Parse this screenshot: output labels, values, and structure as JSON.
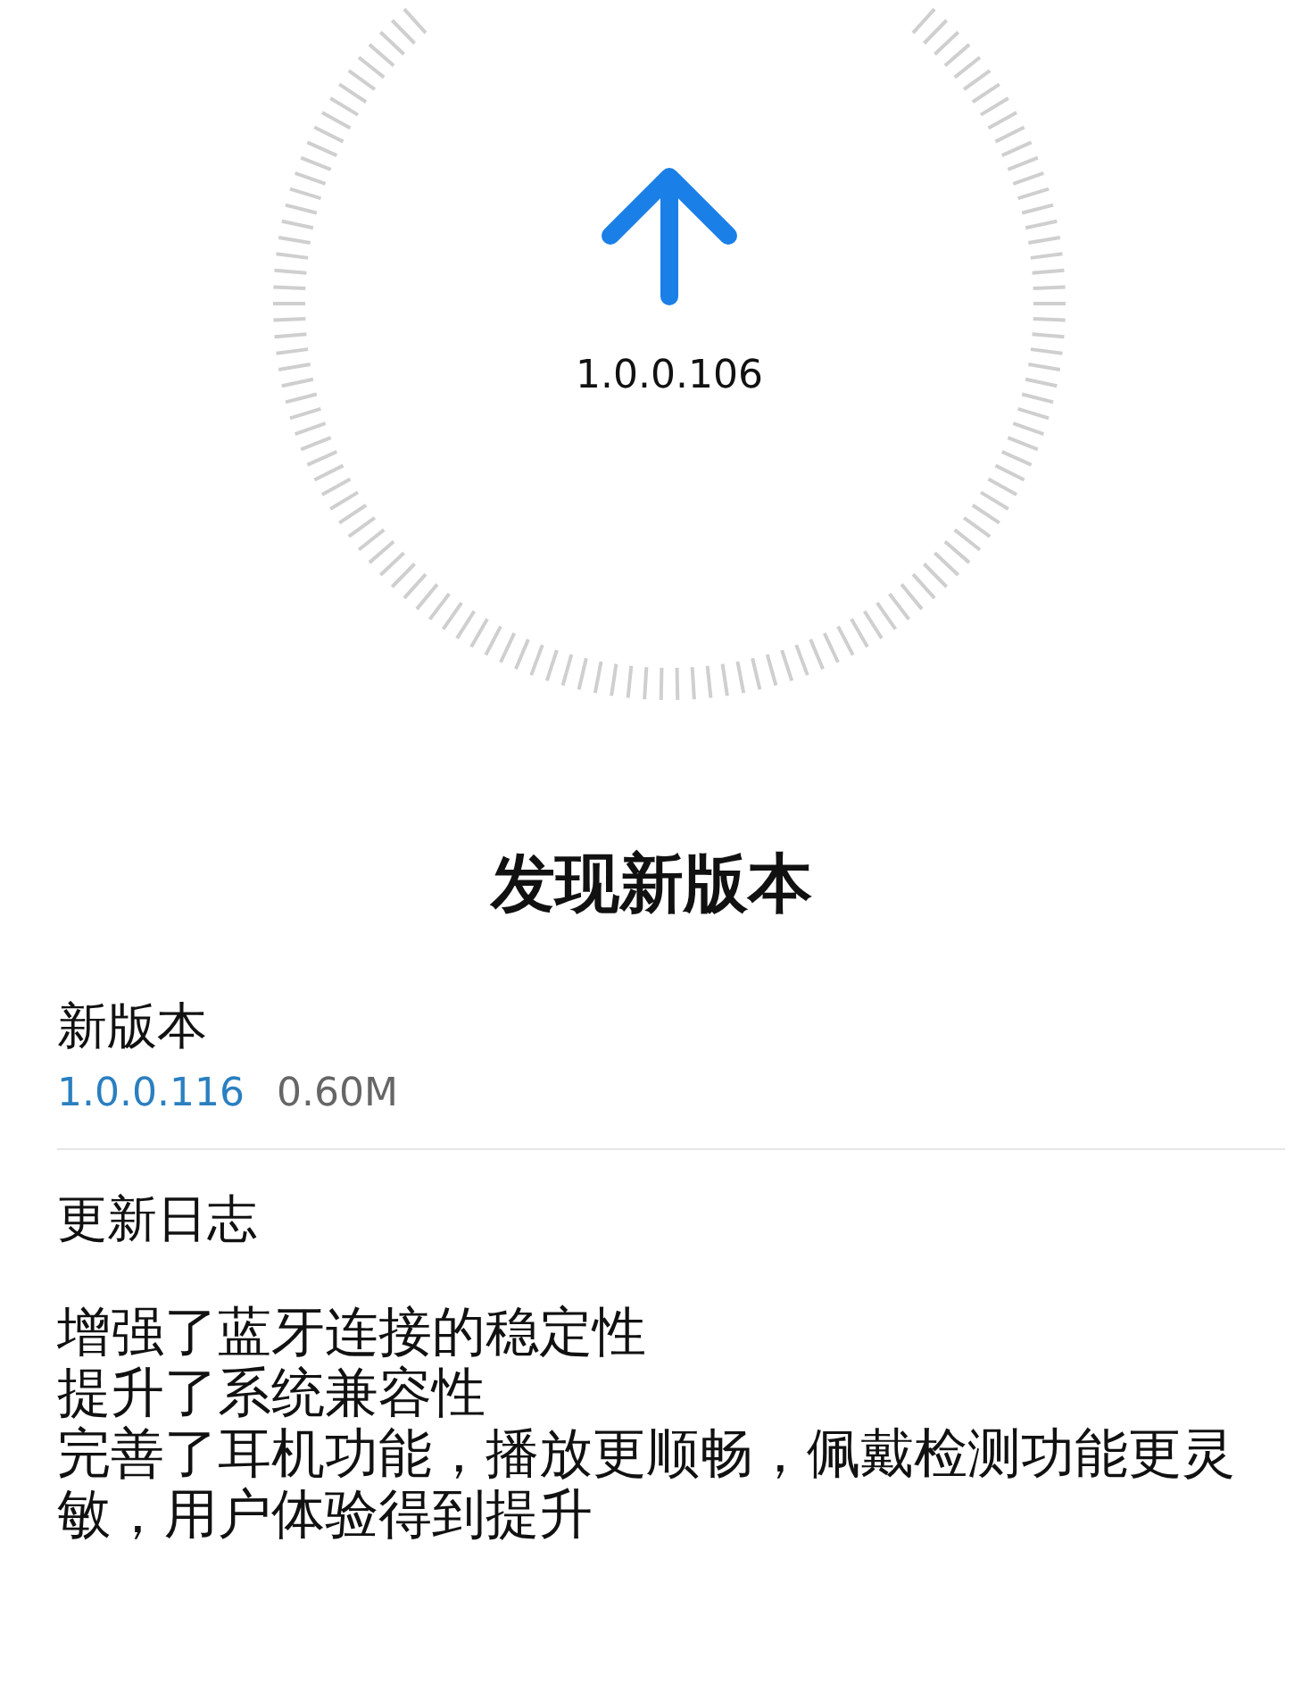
{
  "current_version": "1.0.0.106",
  "title": "发现新版本",
  "new_version": {
    "label": "新版本",
    "version": "1.0.0.116",
    "size": "0.60M"
  },
  "changelog": {
    "label": "更新日志",
    "lines": [
      "增强了蓝牙连接的稳定性",
      "提升了系统兼容性",
      "完善了耳机功能，播放更顺畅，佩戴检测功能更灵敏，用户体验得到提升"
    ]
  }
}
